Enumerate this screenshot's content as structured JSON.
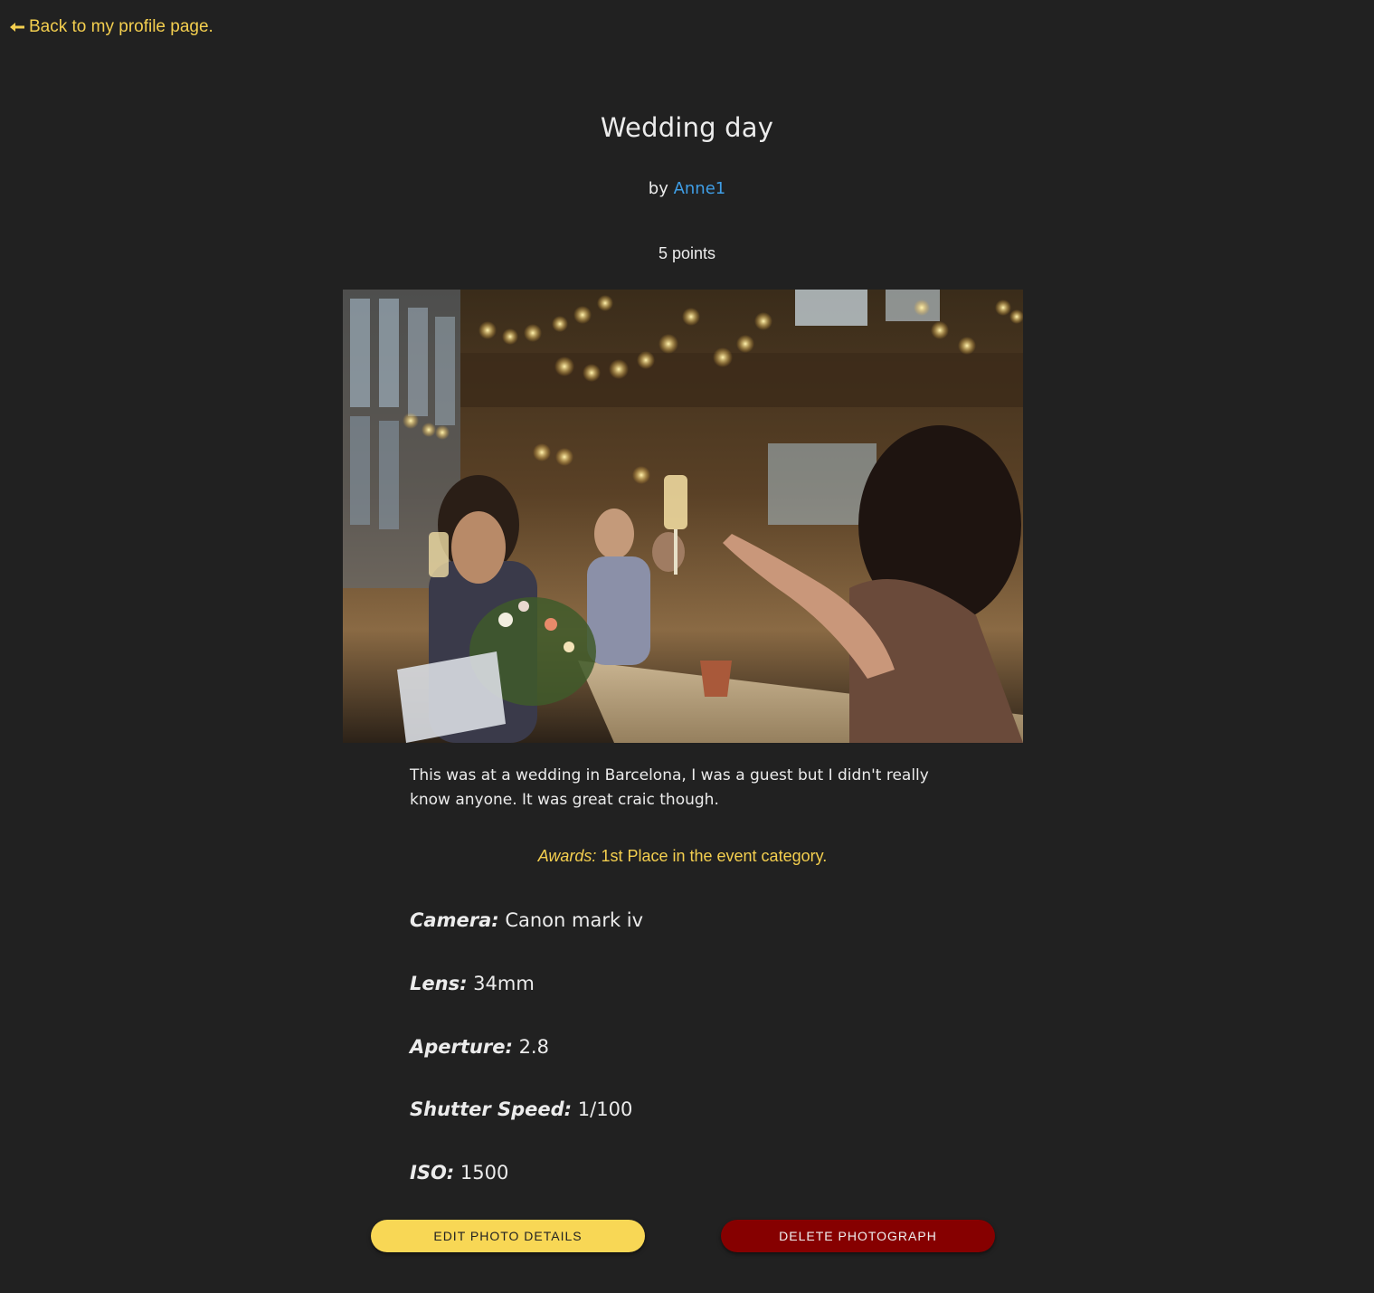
{
  "nav": {
    "back_label": "Back to my profile page."
  },
  "photo": {
    "title": "Wedding day",
    "by_prefix": "by",
    "author": "Anne1",
    "points": "5 points",
    "description": "This was at a wedding in Barcelona, I was a guest but I didn't really know anyone. It was great craic though.",
    "awards_label": "Awards:",
    "awards_value": "1st Place in the event category."
  },
  "specs": {
    "camera_label": "Camera:",
    "camera_value": "Canon mark iv",
    "lens_label": "Lens:",
    "lens_value": "34mm",
    "aperture_label": "Aperture:",
    "aperture_value": "2.8",
    "shutter_label": "Shutter Speed:",
    "shutter_value": "1/100",
    "iso_label": "ISO:",
    "iso_value": "1500"
  },
  "actions": {
    "edit_label": "EDIT PHOTO DETAILS",
    "delete_label": "DELETE PHOTOGRAPH"
  },
  "colors": {
    "background": "#212121",
    "accent_yellow": "#f4cf4f",
    "link_blue": "#3f9ee6",
    "delete_red": "#860000"
  },
  "icons": {
    "back": "arrow-left-icon"
  }
}
